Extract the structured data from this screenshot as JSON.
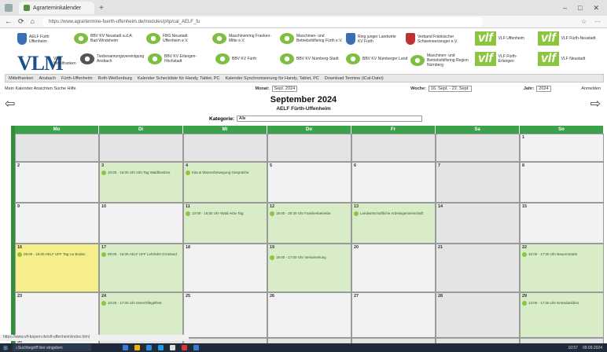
{
  "browser": {
    "tab_title": "Agrarteminkalender",
    "url": "https://www.agrartermine-fuerth-uffenheim.de/modules/php/cal_AELF_fu",
    "nav": [
      "←",
      "⟳",
      "⌂"
    ]
  },
  "banner": {
    "logos": [
      "AELF Fürth Uffenheim",
      "BBV KV Neustadt a.d.A. Bad Windsheim",
      "FBG Neustadt Uffenheim e.V.",
      "Maschinenring Franken-Mitte e.V.",
      "Maschinen- und Betriebshilfsring Fürth e.V.",
      "Ring junger Landwirte KV Fürth",
      "Verband Fränkischer Schweineerzeuger e.V.",
      "VLF Uffenheim",
      "VLF Fürth-Neustadt",
      "VLM Mittelfranken",
      "Tierbesamungsvereinigung Ansbach",
      "BBV KV Erlangen-Höchstadt",
      "BBV KV Fürth",
      "BBV KV Nürnberg-Stadt",
      "BBV KV Nürnberger Land",
      "Maschinen- und Betriebshilfsring Region Nürnberg",
      "VLF Fürth-Erlangen",
      "VLF Neustadt"
    ],
    "big_vim": "VLM"
  },
  "menu": [
    "Mittelfranken",
    "Ansbach",
    "Fürth-Uffenheim",
    "Roth-Weißenburg",
    "Kalender Scheckliste für Handy, Tablet, PC",
    "Kalender Synchronisierung für Handy, Tablet, PC",
    "Download Termine (iCal-Datei)"
  ],
  "toolbar": {
    "left": "Mein Kalender  Ansichten  Suche  Hilfe",
    "monat_label": "Monat:",
    "monat_value": "Sept. 2024",
    "woche_label": "Woche:",
    "woche_value": "16. Sept. - 22. Sept.",
    "jahr_label": "Jahr:",
    "jahr_value": "2024",
    "right": "Anmelden"
  },
  "header": {
    "month": "September 2024",
    "subtitle": "AELF Fürth-Uffenheim",
    "kategorie_label": "Kategorie:",
    "kategorie_value": "Alle"
  },
  "weekdays": [
    "Mo",
    "Di",
    "Mi",
    "Do",
    "Fr",
    "Sa",
    "So"
  ],
  "days": [
    "",
    "",
    "",
    "",
    "",
    "",
    "1",
    "2",
    "3",
    "4",
    "5",
    "6",
    "7",
    "8",
    "9",
    "10",
    "11",
    "12",
    "13",
    "14",
    "15",
    "16",
    "17",
    "18",
    "19",
    "20",
    "21",
    "22",
    "23",
    "24",
    "25",
    "26",
    "27",
    "28",
    "29",
    "30",
    "",
    "",
    "",
    "",
    "",
    ""
  ],
  "events": {
    "e3": "10:00 - 16:00 Uhr Info-Tag Waldbesitzer",
    "e4": "Kita & Wasserbewegung Gespräche",
    "e11": "10:00 - 16:00 Uhr Wald Aktiv Tag",
    "e12": "18:00 - 20:30 Uhr Familienbetriebe",
    "e13": "Landwirtschaftliche Arbeitsgemeinschaft",
    "e16": "09:00 - 16:00 AELF UFF Tag Lw Boden",
    "e17": "09:00 - 16:00 AELF UFF Lehrfahrt Grünland",
    "e19": "18:00 - 17:00 Uhr Versammlung",
    "e22": "10:00 - 17:00 Uhr Bauernmarkt",
    "e24": "10:00 - 17:00 Uhr Dreschflegelfest",
    "e29": "13:00 - 17:00 Uhr Erntedankfest"
  },
  "statusbar": "https://www.vlf-bayern.de/vlf-uffenheim/index.html",
  "taskbar": {
    "search_placeholder": "Suchbegriff hier eingeben",
    "time": "10:57",
    "date": "09.09.2024"
  },
  "colors": {
    "green": "#3aa24a",
    "highlight": "#f5ee8a",
    "event_bg": "#d8ecc8"
  }
}
